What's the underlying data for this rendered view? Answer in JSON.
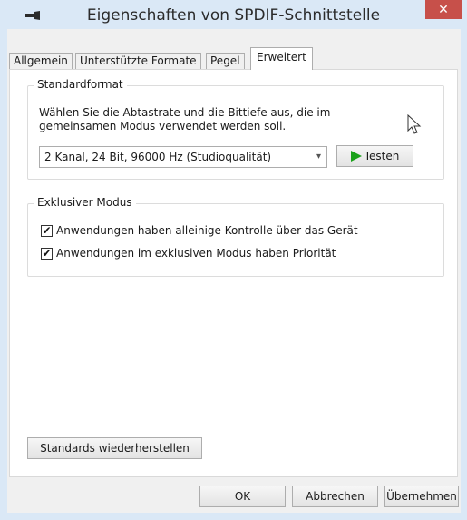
{
  "window": {
    "title": "Eigenschaften von SPDIF-Schnittstelle",
    "close_label": "✕"
  },
  "tabs": [
    {
      "label": "Allgemein",
      "active": false
    },
    {
      "label": "Unterstützte Formate",
      "active": false
    },
    {
      "label": "Pegel",
      "active": false
    },
    {
      "label": "Erweitert",
      "active": true
    }
  ],
  "standardformat": {
    "group_label": "Standardformat",
    "description": "Wählen Sie die Abtastrate und die Bittiefe aus, die im gemeinsamen Modus verwendet werden soll.",
    "selected_format": "2 Kanal, 24 Bit, 96000 Hz (Studioqualität)",
    "test_button_label": "Testen"
  },
  "exclusive_mode": {
    "group_label": "Exklusiver Modus",
    "options": [
      {
        "label": "Anwendungen haben alleinige Kontrolle über das Gerät",
        "checked": true
      },
      {
        "label": "Anwendungen im exklusiven Modus haben Priorität",
        "checked": true
      }
    ]
  },
  "restore_defaults_label": "Standards wiederherstellen",
  "footer": {
    "ok_label": "OK",
    "cancel_label": "Abbrechen",
    "apply_label": "Übernehmen"
  },
  "colors": {
    "title_bar": "#dae8f6",
    "close_button": "#c7504a",
    "test_icon": "#1aa11a"
  }
}
